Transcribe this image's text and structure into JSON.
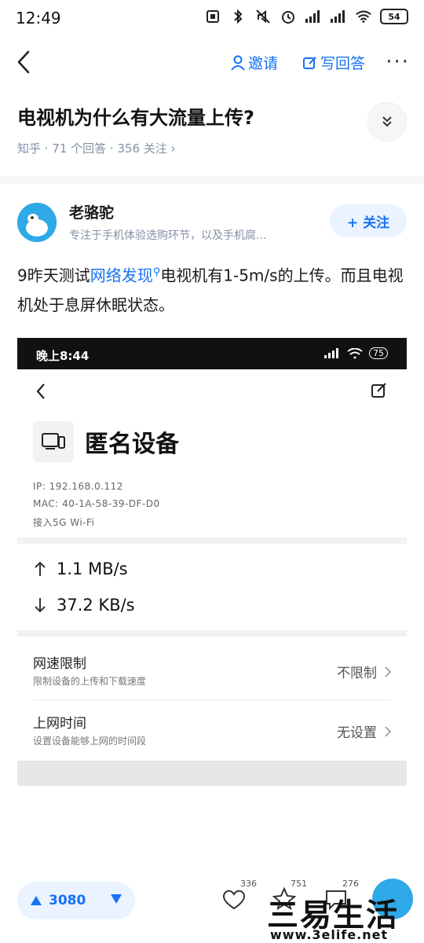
{
  "status_bar": {
    "time": "12:49",
    "battery": "54"
  },
  "nav": {
    "invite_label": "邀请",
    "write_answer_label": "写回答",
    "more_label": "···"
  },
  "question": {
    "title": "电视机为什么有大流量上传?",
    "meta": "知乎 · 71 个回答 · 356 关注 ›"
  },
  "author": {
    "name": "老骆驼",
    "bio": "专注于手机体验选购环节，以及手机腐...",
    "follow_label": "+ 关注"
  },
  "answer": {
    "text_prefix": "9昨天测试",
    "link_text": "网络发现",
    "text_suffix": "电视机有1-5m/s的上传。而且电视机处于息屏休眠状态。"
  },
  "screenshot": {
    "status_time": "晚上8:44",
    "status_battery": "75",
    "device_name": "匿名设备",
    "ip": "IP: 192.168.0.112",
    "mac": "MAC: 40-1A-58-39-DF-D0",
    "connection": "接入5G Wi-Fi",
    "upload_speed": "1.1 MB/s",
    "download_speed": "37.2 KB/s",
    "settings": [
      {
        "title": "网速限制",
        "subtitle": "限制设备的上传和下载速度",
        "value": "不限制"
      },
      {
        "title": "上网时间",
        "subtitle": "设置设备能够上网的时间段",
        "value": "无设置"
      }
    ]
  },
  "bottom_bar": {
    "vote_count": "3080",
    "like_count": "336",
    "favorite_count": "751",
    "comment_count": "276"
  },
  "watermark": {
    "text": "三易生活",
    "url": "www.3elife.net"
  },
  "colors": {
    "accent": "#1772f6",
    "muted": "#8590a6"
  }
}
